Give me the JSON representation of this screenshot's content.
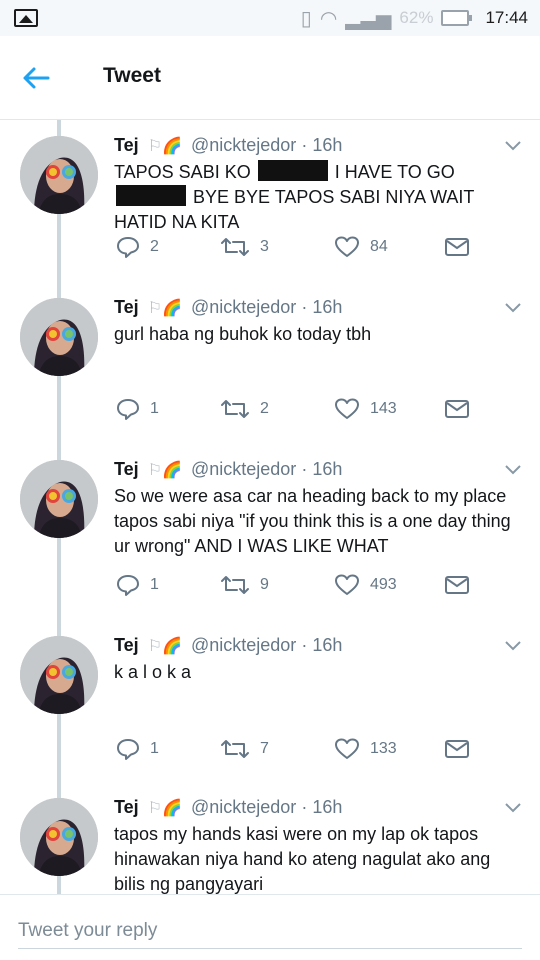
{
  "status_bar": {
    "battery_percent": "62%",
    "time": "17:44",
    "icons": [
      "gallery-icon",
      "vibrate-icon",
      "wifi-icon",
      "signal-icon",
      "battery-icon"
    ]
  },
  "header": {
    "title": "Tweet",
    "back_icon": "arrow-left-icon"
  },
  "tweets": [
    {
      "name": "Tej",
      "flags": "⚐🌈",
      "handle": "@nicktejedor",
      "sep": "·",
      "time": "16h",
      "text_parts": [
        "TAPOS SABI KO ",
        " I HAVE TO GO ",
        " BYE BYE TAPOS SABI NIYA WAIT HATID NA KITA"
      ],
      "replies": "2",
      "retweets": "3",
      "likes": "84"
    },
    {
      "name": "Tej",
      "flags": "⚐🌈",
      "handle": "@nicktejedor",
      "sep": "·",
      "time": "16h",
      "text": "gurl haba ng buhok ko today tbh",
      "replies": "1",
      "retweets": "2",
      "likes": "143"
    },
    {
      "name": "Tej",
      "flags": "⚐🌈",
      "handle": "@nicktejedor",
      "sep": "·",
      "time": "16h",
      "text": "So we were asa car na heading back to my place tapos sabi niya \"if you think this is a one day thing ur wrong\" AND I WAS LIKE WHAT",
      "replies": "1",
      "retweets": "9",
      "likes": "493"
    },
    {
      "name": "Tej",
      "flags": "⚐🌈",
      "handle": "@nicktejedor",
      "sep": "·",
      "time": "16h",
      "text": "k a l o k a",
      "replies": "1",
      "retweets": "7",
      "likes": "133"
    },
    {
      "name": "Tej",
      "flags": "⚐🌈",
      "handle": "@nicktejedor",
      "sep": "·",
      "time": "16h",
      "text": "tapos my hands kasi were on my lap ok tapos hinawakan niya hand ko ateng nagulat ako ang bilis ng pangyayari"
    }
  ],
  "reply": {
    "placeholder": "Tweet your reply"
  },
  "colors": {
    "accent": "#1da1f2",
    "text": "#14171a",
    "secondary": "#657786",
    "thread_line": "#ccd6dd"
  }
}
